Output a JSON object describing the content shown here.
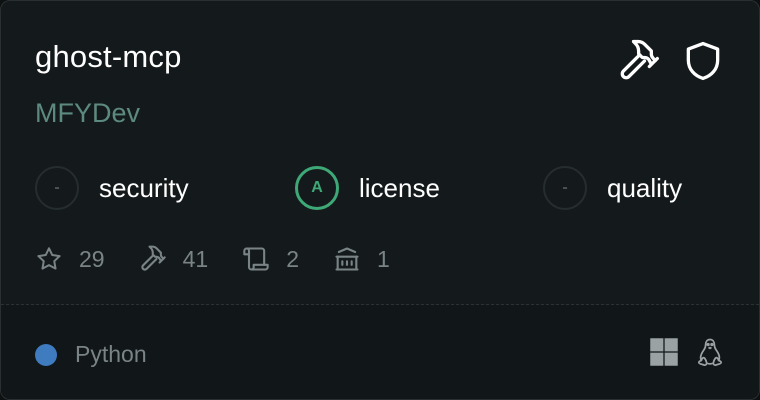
{
  "server": {
    "name": "ghost-mcp",
    "author": "MFYDev"
  },
  "header_icons": [
    "hammer-icon",
    "shield-icon"
  ],
  "scores": [
    {
      "grade": "-",
      "label": "security",
      "status": "none"
    },
    {
      "grade": "A",
      "label": "license",
      "status": "pass"
    },
    {
      "grade": "-",
      "label": "quality",
      "status": "none"
    }
  ],
  "stats": {
    "stars": "29",
    "tools": "41",
    "prompts": "2",
    "resources": "1"
  },
  "language": {
    "name": "Python",
    "color": "#3f7bbf"
  },
  "platforms": [
    "windows-icon",
    "linux-icon"
  ],
  "colors": {
    "grade_pass": "#3fa877",
    "author": "#5d8a80"
  }
}
